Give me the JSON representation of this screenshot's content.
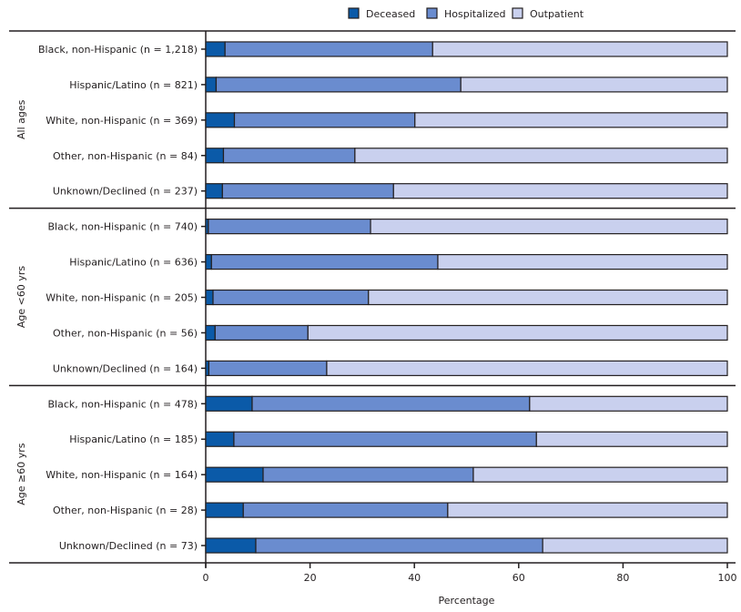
{
  "chart_data": {
    "type": "bar",
    "orientation": "horizontal",
    "stacked": true,
    "title": "",
    "xlabel": "Percentage",
    "ylabel": "",
    "xlim": [
      0,
      100
    ],
    "xticks": [
      0,
      20,
      40,
      60,
      80,
      100
    ],
    "grid": false,
    "legend_position": "top",
    "legend": [
      "Deceased",
      "Hospitalized",
      "Outpatient"
    ],
    "colors": {
      "Deceased": "#0b5aa8",
      "Hospitalized": "#6a8ccf",
      "Outpatient": "#c9d0ee"
    },
    "groups": [
      {
        "label": "All ages",
        "categories": [
          {
            "label": "Black, non-Hispanic (n = 1,218)",
            "deceased": 3.7,
            "hospitalized": 39.8,
            "outpatient": 56.5
          },
          {
            "label": "Hispanic/Latino (n = 821)",
            "deceased": 2.0,
            "hospitalized": 46.9,
            "outpatient": 51.1
          },
          {
            "label": "White, non-Hispanic (n = 369)",
            "deceased": 5.5,
            "hospitalized": 34.6,
            "outpatient": 59.9
          },
          {
            "label": "Other, non-Hispanic (n = 84)",
            "deceased": 3.4,
            "hospitalized": 25.2,
            "outpatient": 71.4
          },
          {
            "label": "Unknown/Declined (n = 237)",
            "deceased": 3.2,
            "hospitalized": 32.8,
            "outpatient": 64.0
          }
        ]
      },
      {
        "label": "Age <60 yrs",
        "categories": [
          {
            "label": "Black, non-Hispanic (n = 740)",
            "deceased": 0.5,
            "hospitalized": 31.1,
            "outpatient": 68.4
          },
          {
            "label": "Hispanic/Latino (n = 636)",
            "deceased": 1.1,
            "hospitalized": 43.4,
            "outpatient": 55.5
          },
          {
            "label": "White, non-Hispanic (n = 205)",
            "deceased": 1.4,
            "hospitalized": 29.8,
            "outpatient": 68.8
          },
          {
            "label": "Other, non-Hispanic (n = 56)",
            "deceased": 1.8,
            "hospitalized": 17.8,
            "outpatient": 80.4
          },
          {
            "label": "Unknown/Declined (n = 164)",
            "deceased": 0.6,
            "hospitalized": 22.6,
            "outpatient": 76.8
          }
        ]
      },
      {
        "label": "Age ≥60 yrs",
        "categories": [
          {
            "label": "Black, non-Hispanic (n = 478)",
            "deceased": 8.9,
            "hospitalized": 53.2,
            "outpatient": 37.9
          },
          {
            "label": "Hispanic/Latino (n = 185)",
            "deceased": 5.4,
            "hospitalized": 58.0,
            "outpatient": 36.6
          },
          {
            "label": "White, non-Hispanic (n = 164)",
            "deceased": 11.0,
            "hospitalized": 40.3,
            "outpatient": 48.7
          },
          {
            "label": "Other, non-Hispanic (n = 28)",
            "deceased": 7.2,
            "hospitalized": 39.2,
            "outpatient": 53.6
          },
          {
            "label": "Unknown/Declined (n = 73)",
            "deceased": 9.6,
            "hospitalized": 55.0,
            "outpatient": 35.4
          }
        ]
      }
    ]
  }
}
